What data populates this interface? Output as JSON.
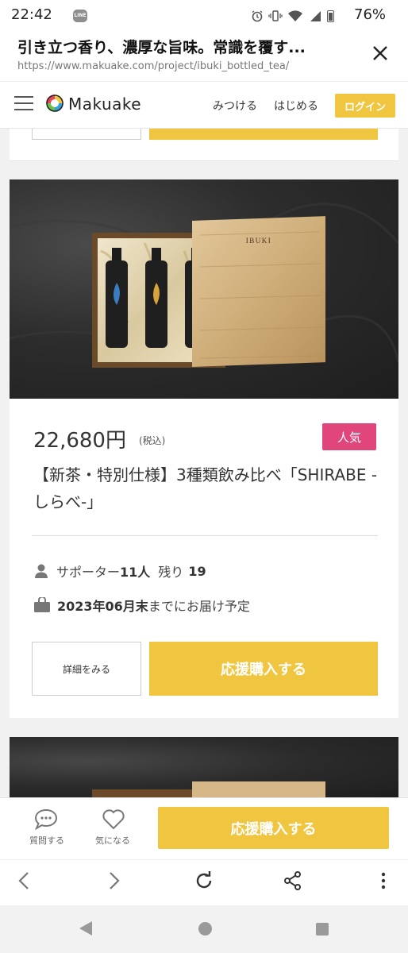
{
  "status_bar": {
    "time": "22:42",
    "app_badge": "LINE",
    "battery": "76%"
  },
  "browser": {
    "page_title": "引き立つ香り、濃厚な旨味。常識を覆す...",
    "url": "https://www.makuake.com/project/ibuki_bottled_tea/"
  },
  "site_header": {
    "logo": "Makuake",
    "nav": {
      "discover": "みつける",
      "start": "はじめる"
    },
    "login_label": "ログイン"
  },
  "product": {
    "box_brand": "IBUKI",
    "price": "22,680円",
    "tax_label": "(税込)",
    "badge": "人気",
    "title": "【新茶・特別仕様】3種類飲み比べ「SHIRABE -しらべ-」",
    "supporters_label": "サポーター",
    "supporters_count": "11人",
    "remaining_label": "残り",
    "remaining_count": "19",
    "delivery_date": "2023年06月末",
    "delivery_suffix": "までにお届け予定",
    "detail_label": "詳細をみる",
    "buy_label": "応援購入する"
  },
  "action_bar": {
    "ask_label": "質問する",
    "favorite_label": "気になる",
    "buy_label": "応援購入する"
  },
  "colors": {
    "accent": "#f0c641",
    "badge": "#e0457b"
  }
}
